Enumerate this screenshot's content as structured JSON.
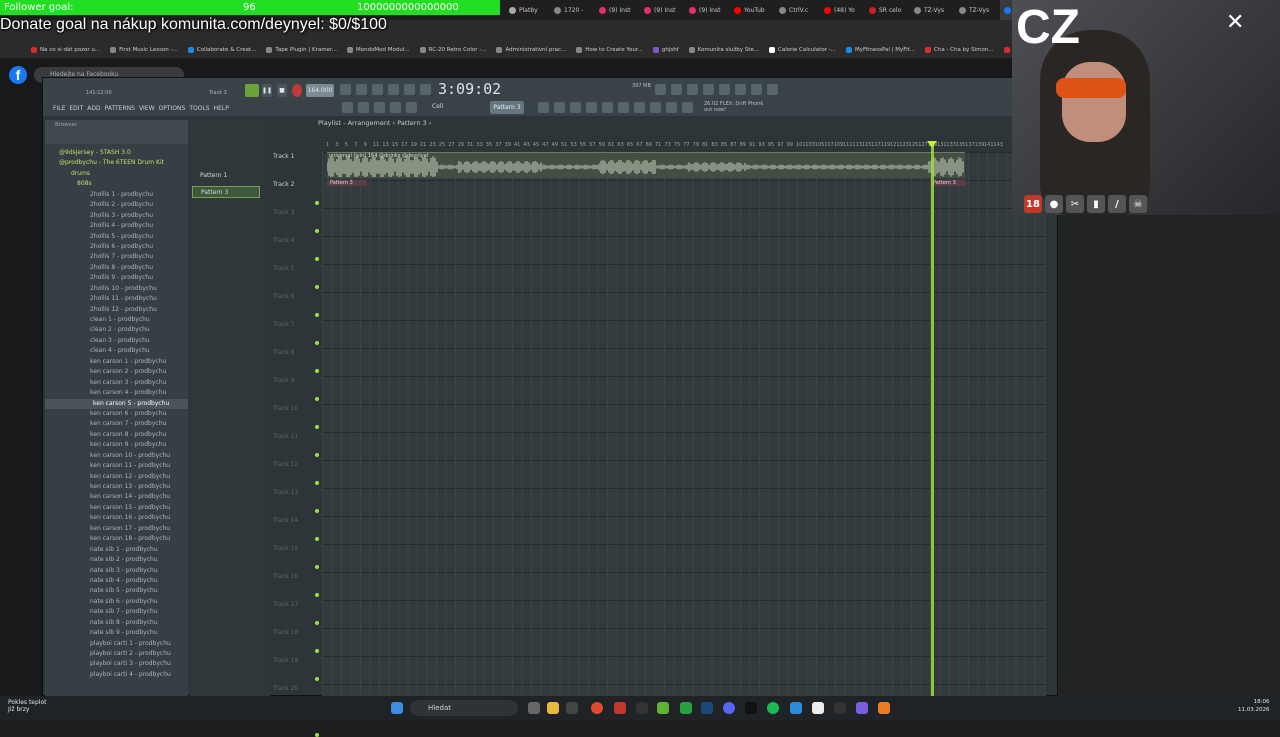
{
  "overlay": {
    "follower_label": "Follower goal:",
    "follower_count": "96",
    "follower_goal": "1000000000000000",
    "donate_text": "Donate goal na nákup komunita.com/deynyel: $0/$100",
    "bar_color": "#22dd22"
  },
  "browser_tabs": [
    {
      "label": "Platby",
      "color": "#aaaaaa"
    },
    {
      "label": "1720 -",
      "color": "#888888"
    },
    {
      "label": "(9) Inst",
      "color": "#e1306c"
    },
    {
      "label": "(9) Inst",
      "color": "#e1306c"
    },
    {
      "label": "(9) Inst",
      "color": "#e1306c"
    },
    {
      "label": "YouTub",
      "color": "#ff0000"
    },
    {
      "label": "CtrlV.c",
      "color": "#888888"
    },
    {
      "label": "(48) Yo",
      "color": "#ff0000"
    },
    {
      "label": "SR celo",
      "color": "#cc2222"
    },
    {
      "label": "TZ-Vys",
      "color": "#888888"
    },
    {
      "label": "TZ-Vys",
      "color": "#888888"
    },
    {
      "label": "Mi",
      "color": "#1877f2"
    }
  ],
  "bookmarks": [
    {
      "label": "Na co si dát pozor u...",
      "color": "#d32f2f"
    },
    {
      "label": "First Music Lesson -...",
      "color": "#888"
    },
    {
      "label": "Collaborate & Creat...",
      "color": "#1e88e5"
    },
    {
      "label": "Tape Plugin | Kramer...",
      "color": "#888"
    },
    {
      "label": "MondoMod Modul...",
      "color": "#888"
    },
    {
      "label": "RC-20 Retro Color -...",
      "color": "#888"
    },
    {
      "label": "Administrativní prac...",
      "color": "#888"
    },
    {
      "label": "How to Create Your...",
      "color": "#888"
    },
    {
      "label": "ghjshf",
      "color": "#7e57c2"
    },
    {
      "label": "Komunita služby Ste...",
      "color": "#888"
    },
    {
      "label": "Calorie Calculator -...",
      "color": "#fff"
    },
    {
      "label": "MyFitnessPal | MyFit...",
      "color": "#1e88e5"
    },
    {
      "label": "Cha - Cha by Simon...",
      "color": "#d32f2f"
    },
    {
      "label": "Hyp",
      "color": "#d32f2f"
    }
  ],
  "facebook": {
    "search_placeholder": "Hledejte na Facebooku"
  },
  "fl": {
    "menu": [
      "FILE",
      "EDIT",
      "ADD",
      "PATTERNS",
      "VIEW",
      "OPTIONS",
      "TOOLS",
      "HELP"
    ],
    "tempo": "164.000",
    "time": "3:09:02",
    "pattern": "Pattern 3",
    "snap": "Cell",
    "position": "141:12:00",
    "track_label": "Track 3",
    "memory": "397 MB",
    "hint_line1": "26.02 FLEX: Drift Phonk",
    "hint_line2": "out now!",
    "playlist_title": "Playlist - Arrangement › Pattern 3 ›",
    "browser_label": "Browser",
    "patterns": [
      "Pattern 1",
      "Pattern 3"
    ],
    "ruler": [
      "1",
      "3",
      "5",
      "7",
      "9",
      "11",
      "13",
      "15",
      "17",
      "19",
      "21",
      "23",
      "25",
      "27",
      "29",
      "31",
      "33",
      "35",
      "37",
      "39",
      "41",
      "43",
      "45",
      "47",
      "49",
      "51",
      "53",
      "55",
      "57",
      "59",
      "61",
      "63",
      "65",
      "67",
      "69",
      "71",
      "73",
      "75",
      "77",
      "79",
      "81",
      "83",
      "85",
      "87",
      "89",
      "91",
      "93",
      "95",
      "97",
      "99",
      "101",
      "103",
      "105",
      "107",
      "109",
      "111",
      "113",
      "115",
      "117",
      "119",
      "121",
      "123",
      "125",
      "127",
      "129",
      "131",
      "133",
      "135",
      "137",
      "139",
      "141",
      "143"
    ],
    "tracks": [
      "Track 1",
      "Track 2",
      "Track 3",
      "Track 4",
      "Track 5",
      "Track 6",
      "Track 7",
      "Track 8",
      "Track 9",
      "Track 10",
      "Track 11",
      "Track 12",
      "Track 13",
      "Track 14",
      "Track 15",
      "Track 16",
      "Track 17",
      "Track 18",
      "Track 19",
      "Track 20"
    ],
    "clip1_label": "universal (lyin) 164 @dnlnkz @deynlyel",
    "clip2_label": "Pattern 3",
    "browser_items": [
      {
        "label": "@9dsjersey - STASH 3.0",
        "type": "folder"
      },
      {
        "label": "@prodbychu - The 6TEEN Drum Kit",
        "type": "folder"
      },
      {
        "label": "drums",
        "type": "folder"
      },
      {
        "label": "808s",
        "type": "folder"
      },
      {
        "label": "2hollis 1 - prodbychu",
        "type": "file"
      },
      {
        "label": "2hollis 2 - prodbychu",
        "type": "file"
      },
      {
        "label": "2hollis 3 - prodbychu",
        "type": "file"
      },
      {
        "label": "2hollis 4 - prodbychu",
        "type": "file"
      },
      {
        "label": "2hollis 5 - prodbychu",
        "type": "file"
      },
      {
        "label": "2hollis 6 - prodbychu",
        "type": "file"
      },
      {
        "label": "2hollis 7 - prodbychu",
        "type": "file"
      },
      {
        "label": "2hollis 8 - prodbychu",
        "type": "file"
      },
      {
        "label": "2hollis 9 - prodbychu",
        "type": "file"
      },
      {
        "label": "2hollis 10 - prodbychu",
        "type": "file"
      },
      {
        "label": "2hollis 11 - prodbychu",
        "type": "file"
      },
      {
        "label": "2hollis 12 - prodbychu",
        "type": "file"
      },
      {
        "label": "clean 1 - prodbychu",
        "type": "file"
      },
      {
        "label": "clean 2 - prodbychu",
        "type": "file"
      },
      {
        "label": "clean 3 - prodbychu",
        "type": "file"
      },
      {
        "label": "clean 4 - prodbychu",
        "type": "file"
      },
      {
        "label": "ken carson 1 - prodbychu",
        "type": "file"
      },
      {
        "label": "ken carson 2 - prodbychu",
        "type": "file"
      },
      {
        "label": "ken carson 3 - prodbychu",
        "type": "file"
      },
      {
        "label": "ken carson 4 - prodbychu",
        "type": "file"
      },
      {
        "label": "ken carson 5 - prodbychu",
        "type": "selected"
      },
      {
        "label": "ken carson 6 - prodbychu",
        "type": "file"
      },
      {
        "label": "ken carson 7 - prodbychu",
        "type": "file"
      },
      {
        "label": "ken carson 8 - prodbychu",
        "type": "file"
      },
      {
        "label": "ken carson 9 - prodbychu",
        "type": "file"
      },
      {
        "label": "ken carson 10 - prodbychu",
        "type": "file"
      },
      {
        "label": "ken carson 11 - prodbychu",
        "type": "file"
      },
      {
        "label": "ken carson 12 - prodbychu",
        "type": "file"
      },
      {
        "label": "ken carson 13 - prodbychu",
        "type": "file"
      },
      {
        "label": "ken carson 14 - prodbychu",
        "type": "file"
      },
      {
        "label": "ken carson 15 - prodbychu",
        "type": "file"
      },
      {
        "label": "ken carson 16 - prodbychu",
        "type": "file"
      },
      {
        "label": "ken carson 17 - prodbychu",
        "type": "file"
      },
      {
        "label": "ken carson 18 - prodbychu",
        "type": "file"
      },
      {
        "label": "nate sib 1 - prodbychu",
        "type": "file"
      },
      {
        "label": "nate sib 2 - prodbychu",
        "type": "file"
      },
      {
        "label": "nate sib 3 - prodbychu",
        "type": "file"
      },
      {
        "label": "nate sib 4 - prodbychu",
        "type": "file"
      },
      {
        "label": "nate sib 5 - prodbychu",
        "type": "file"
      },
      {
        "label": "nate sib 6 - prodbychu",
        "type": "file"
      },
      {
        "label": "nate sib 7 - prodbychu",
        "type": "file"
      },
      {
        "label": "nate sib 8 - prodbychu",
        "type": "file"
      },
      {
        "label": "nate sib 9 - prodbychu",
        "type": "file"
      },
      {
        "label": "playboi carti 1 - prodbychu",
        "type": "file"
      },
      {
        "label": "playboi carti 2 - prodbychu",
        "type": "file"
      },
      {
        "label": "playboi carti 3 - prodbychu",
        "type": "file"
      },
      {
        "label": "playboi carti 4 - prodbychu",
        "type": "file"
      }
    ]
  },
  "webcam": {
    "title": "CZ",
    "badge_18": "18"
  },
  "taskbar": {
    "weather_line1": "Pokles teplot",
    "weather_line2": "Již brzy",
    "search_label": "Hledat",
    "time": "18:06",
    "date": "11.03.2026"
  }
}
